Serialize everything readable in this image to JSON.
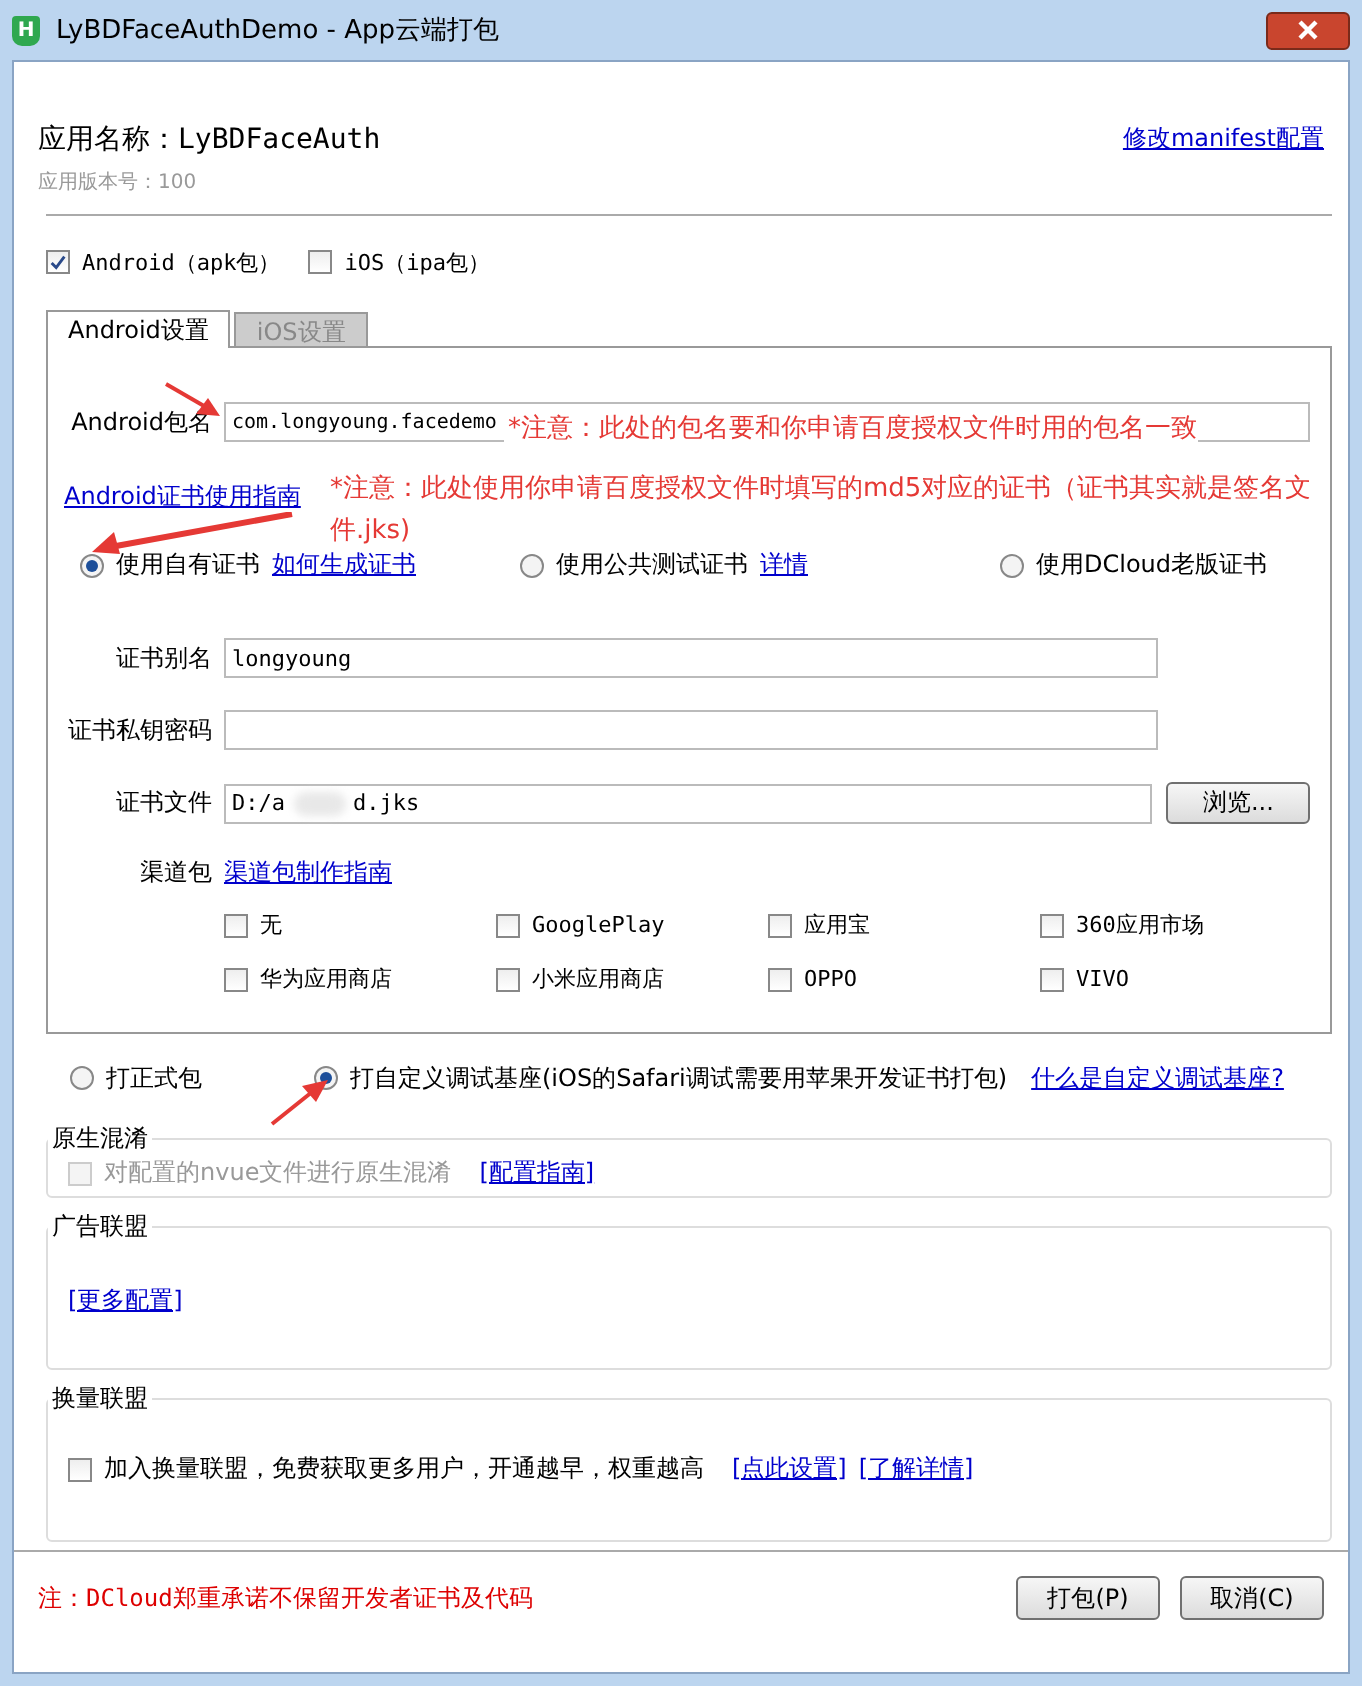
{
  "window": {
    "title": "LyBDFaceAuthDemo - App云端打包",
    "logo": "H"
  },
  "app": {
    "name_label": "应用名称：LyBDFaceAuth",
    "version": "应用版本号：100",
    "manifest_link": "修改manifest配置"
  },
  "platforms": [
    {
      "label": "Android（apk包）",
      "checked": true
    },
    {
      "label": "iOS（ipa包）",
      "checked": false
    }
  ],
  "tabs": [
    {
      "label": "Android设置",
      "selected": true
    },
    {
      "label": "iOS设置",
      "selected": false
    }
  ],
  "package": {
    "label": "Android包名",
    "value": "com.longyoung.facedemo"
  },
  "cert_guide_link": "Android证书使用指南",
  "cert_options": [
    {
      "label": "使用自有证书",
      "link": "如何生成证书",
      "selected": true
    },
    {
      "label": "使用公共测试证书",
      "link": "详情",
      "selected": false
    },
    {
      "label": "使用DCloud老版证书",
      "selected": false
    }
  ],
  "fields": [
    {
      "kind": "text",
      "label": "证书别名",
      "value": "longyoung"
    },
    {
      "kind": "password",
      "label": "证书私钥密码"
    },
    {
      "kind": "file",
      "label": "证书文件",
      "value_start": "D:/a",
      "value_end": "d.jks",
      "button": "浏览..."
    }
  ],
  "channels": {
    "label": "渠道包",
    "link": "渠道包制作指南",
    "items": [
      {
        "label": "无",
        "checked": false
      },
      {
        "label": "GooglePlay",
        "checked": false
      },
      {
        "label": "应用宝",
        "checked": false
      },
      {
        "label": "360应用市场",
        "checked": false
      },
      {
        "label": "华为应用商店",
        "checked": false
      },
      {
        "label": "小米应用商店",
        "checked": false
      },
      {
        "label": "OPPO",
        "checked": false
      },
      {
        "label": "VIVO",
        "checked": false
      }
    ]
  },
  "build_types": [
    {
      "label": "打正式包",
      "selected": false
    },
    {
      "label": "打自定义调试基座(iOS的Safari调试需要用苹果开发证书打包)",
      "selected": true
    }
  ],
  "build_link": "什么是自定义调试基座?",
  "obfuscation": {
    "title": "原生混淆",
    "label": "对配置的nvue文件进行原生混淆",
    "checked": false,
    "disabled": true,
    "link": "[配置指南]"
  },
  "ads": {
    "title": "广告联盟",
    "link": "[更多配置]"
  },
  "exchange": {
    "title": "换量联盟",
    "label": "加入换量联盟，免费获取更多用户，开通越早，权重越高",
    "checked": false,
    "links": [
      "[点此设置]",
      "[了解详情]"
    ]
  },
  "footer": {
    "note": "注：DCloud郑重承诺不保留开发者证书及代码",
    "buttons": [
      "打包(P)",
      "取消(C)"
    ]
  },
  "annotations": [
    "*注意：此处的包名要和你申请百度授权文件时用的包名一致",
    "*注意：此处使用你申请百度授权文件时填写的md5对应的证书（证书其实就是签名文件.jks)"
  ]
}
